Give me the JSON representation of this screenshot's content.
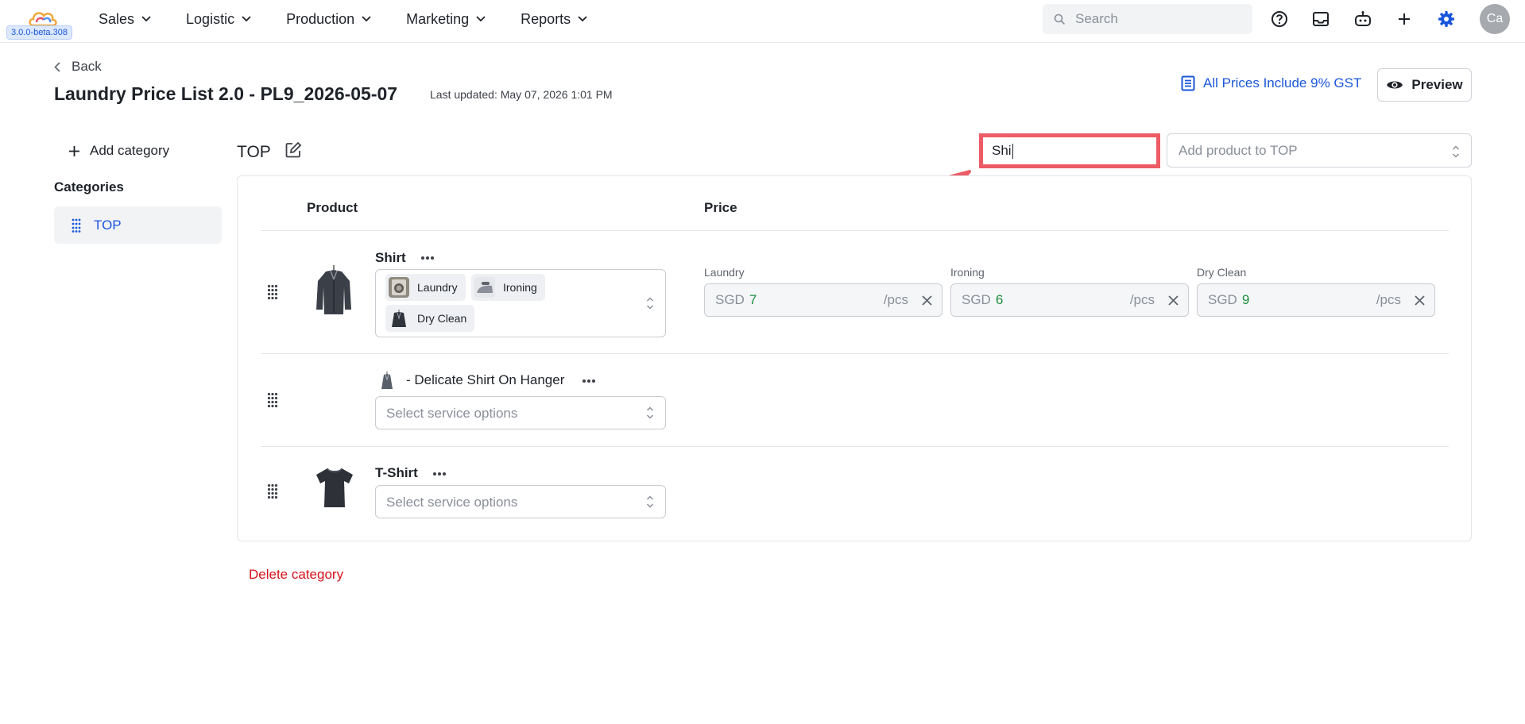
{
  "app": {
    "version": "3.0.0-beta.308",
    "nav": [
      "Sales",
      "Logistic",
      "Production",
      "Marketing",
      "Reports"
    ],
    "search_placeholder": "Search",
    "avatar_initials": "Ca",
    "accent_color": "#1a56db"
  },
  "header": {
    "back_label": "Back",
    "title": "Laundry Price List 2.0 - PL9_2026-05-07",
    "last_updated": "Last updated: May 07, 2026 1:01 PM",
    "gst_label": "All Prices Include 9% GST",
    "preview_label": "Preview"
  },
  "sidebar": {
    "add_category_label": "Add category",
    "categories_label": "Categories",
    "items": [
      {
        "label": "TOP",
        "selected": true
      }
    ]
  },
  "category": {
    "name": "TOP",
    "filter_value": "Shi",
    "add_product_placeholder": "Add product to TOP",
    "columns": {
      "product": "Product",
      "price": "Price"
    },
    "delete_label": "Delete category",
    "products": [
      {
        "name": "Shirt",
        "image_icon": "shirt-jacket-icon",
        "services": [
          "Laundry",
          "Ironing",
          "Dry Clean"
        ],
        "prices": [
          {
            "label": "Laundry",
            "currency": "SGD",
            "value": "7",
            "unit": "/pcs"
          },
          {
            "label": "Ironing",
            "currency": "SGD",
            "value": "6",
            "unit": "/pcs"
          },
          {
            "label": "Dry Clean",
            "currency": "SGD",
            "value": "9",
            "unit": "/pcs"
          }
        ]
      },
      {
        "name": "- Delicate Shirt On Hanger",
        "image_icon": "hanger-shirt-icon",
        "service_placeholder": "Select service options"
      },
      {
        "name": "T-Shirt",
        "image_icon": "tshirt-icon",
        "service_placeholder": "Select service options"
      }
    ]
  },
  "annotation": {
    "color": "#ec5b66"
  }
}
